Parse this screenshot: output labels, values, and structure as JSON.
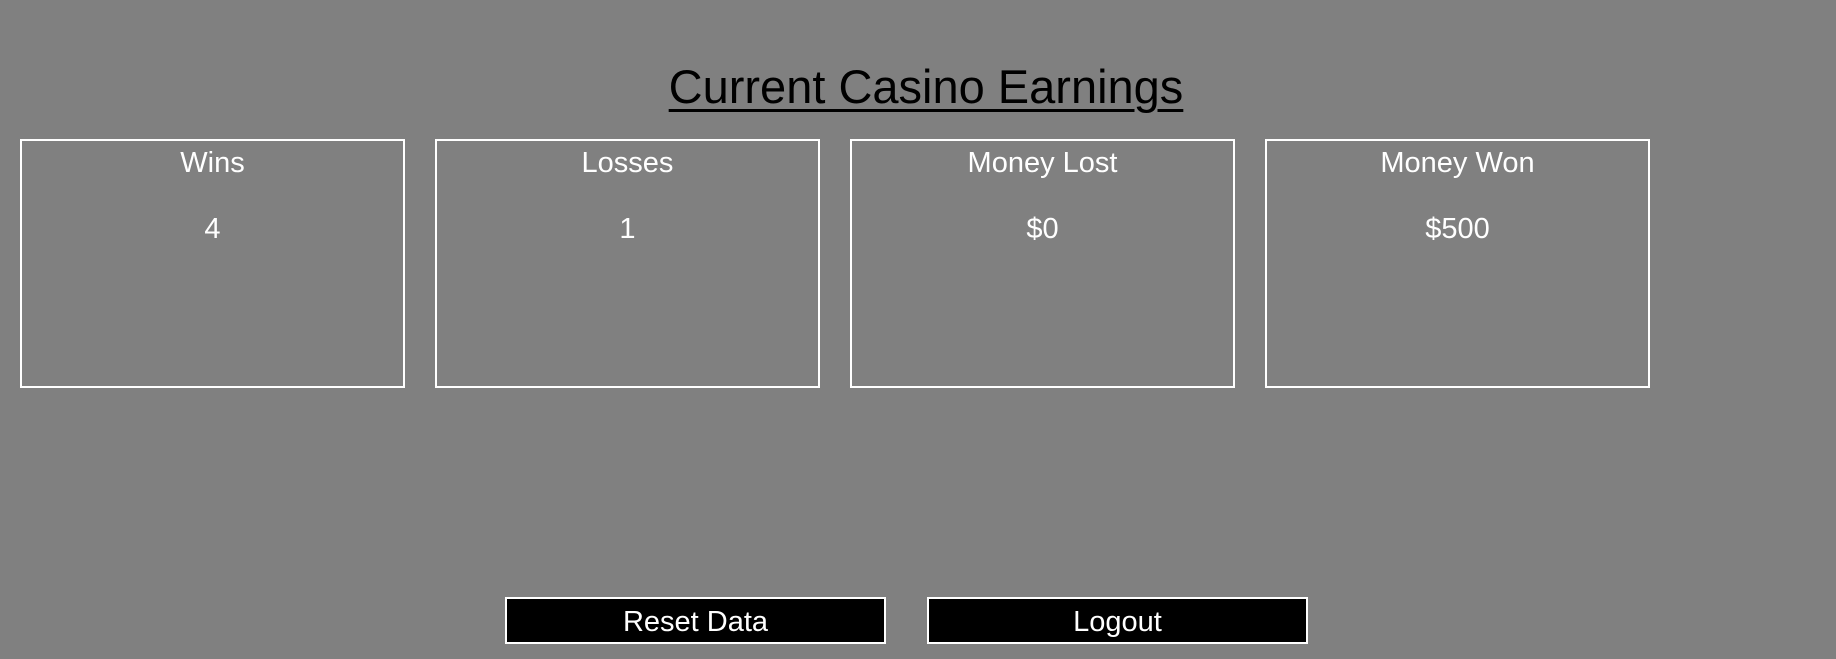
{
  "header": {
    "title": "Current Casino Earnings"
  },
  "stats": [
    {
      "label": "Wins",
      "value": "4"
    },
    {
      "label": "Losses",
      "value": "1"
    },
    {
      "label": "Money Lost",
      "value": "$0"
    },
    {
      "label": "Money Won",
      "value": "$500"
    }
  ],
  "actions": {
    "reset_label": "Reset Data",
    "logout_label": "Logout"
  },
  "colors": {
    "background": "#808080",
    "title": "#000000",
    "card_border": "#ffffff",
    "button_bg": "#000000",
    "button_text": "#ffffff"
  }
}
